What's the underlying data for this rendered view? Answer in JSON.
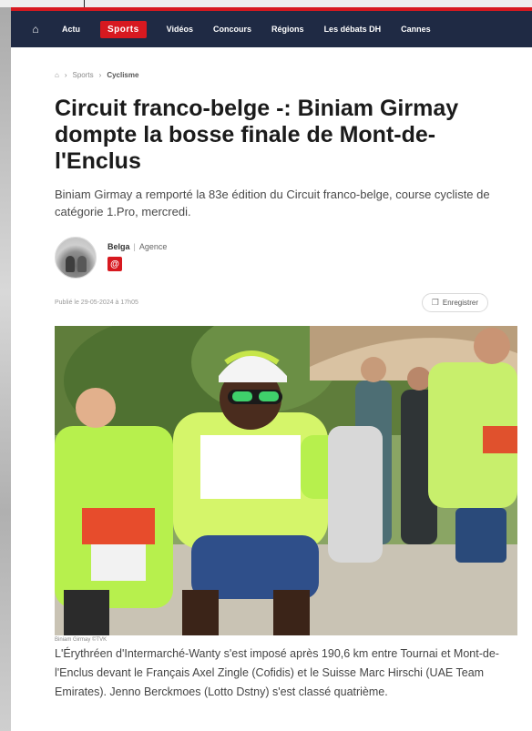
{
  "nav": {
    "items": [
      "Actu",
      "Sports",
      "Vidéos",
      "Concours",
      "Régions",
      "Les débats DH",
      "Cannes"
    ]
  },
  "breadcrumb": {
    "items": [
      "Sports",
      "Cyclisme"
    ]
  },
  "article": {
    "title": "Circuit franco-belge -: Biniam Girmay dompte la bosse finale de Mont-de-l'Enclus",
    "lead": "Biniam Girmay a remporté la 83e édition du Circuit franco-belge, course cycliste de catégorie 1.Pro, mercredi.",
    "author": "Belga",
    "author_role": "Agence",
    "published": "Publié le 29-05-2024 à 17h05",
    "save_label": "Enregistrer",
    "photo_caption": "Biniam Girmay ©TVK",
    "body": "L'Érythréen d'Intermarché-Wanty s'est imposé après 190,6 km entre Tournai et Mont-de-l'Enclus devant le Français Axel Zingle (Cofidis) et le Suisse Marc Hirschi (UAE Team Emirates). Jenno Berckmoes (Lotto Dstny) s'est classé quatrième."
  },
  "icons": {
    "home": "home-icon",
    "bookmark": "bookmark-icon",
    "author_badge": "author-badge-icon"
  },
  "colors": {
    "nav_bg": "#1f2a44",
    "accent": "#d71920"
  }
}
